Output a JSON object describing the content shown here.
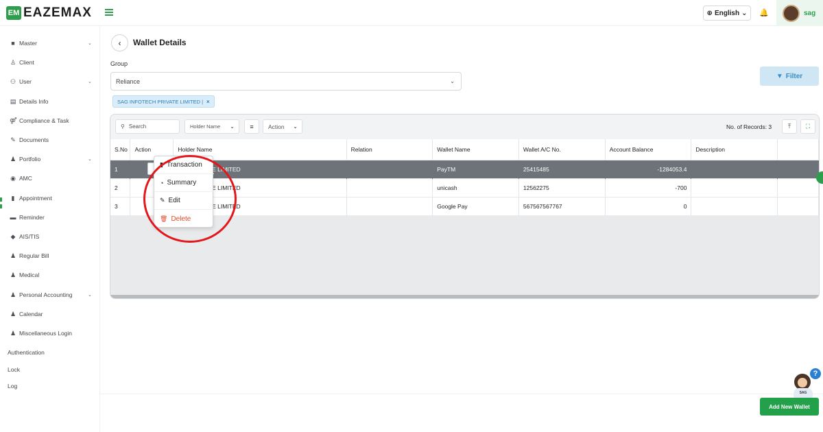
{
  "header": {
    "logo_mark": "EM",
    "logo_text": "EAZEMAX",
    "language": "English",
    "user_name": "sag"
  },
  "sidebar": {
    "items": [
      {
        "label": "Master",
        "icon": "box-icon",
        "chevron": true
      },
      {
        "label": "Client",
        "icon": "client-icon",
        "chevron": false
      },
      {
        "label": "User",
        "icon": "user-group-icon",
        "chevron": true
      },
      {
        "label": "Details Info",
        "icon": "details-icon",
        "chevron": false
      },
      {
        "label": "Compliance & Task",
        "icon": "compliance-icon",
        "chevron": false
      },
      {
        "label": "Documents",
        "icon": "documents-icon",
        "chevron": false
      },
      {
        "label": "Portfolio",
        "icon": "portfolio-icon",
        "chevron": true
      },
      {
        "label": "AMC",
        "icon": "amc-icon",
        "chevron": false
      },
      {
        "label": "Appointment",
        "icon": "appointment-icon",
        "chevron": false
      },
      {
        "label": "Reminder",
        "icon": "reminder-icon",
        "chevron": false
      },
      {
        "label": "AIS/TIS",
        "icon": "tag-icon",
        "chevron": false
      },
      {
        "label": "Regular Bill",
        "icon": "bill-icon",
        "chevron": false
      },
      {
        "label": "Medical",
        "icon": "medical-icon",
        "chevron": false
      },
      {
        "label": "Personal Accounting",
        "icon": "accounting-icon",
        "chevron": true
      },
      {
        "label": "Calendar",
        "icon": "calendar-icon",
        "chevron": false
      },
      {
        "label": "Miscellaneous Login",
        "icon": "login-icon",
        "chevron": false
      }
    ],
    "plain_items": [
      "Authentication",
      "Lock",
      "Log"
    ]
  },
  "page": {
    "title": "Wallet Details",
    "group_label": "Group",
    "group_value": "Reliance",
    "filter_label": "Filter",
    "chip_label": "SAG INFOTECH PRIVATE LIMITED |",
    "chip_close": "×"
  },
  "toolbar": {
    "search_placeholder": "Search",
    "holder_select": "Holder Name",
    "action_select": "Action",
    "records_text": "No. of Records: 3"
  },
  "table": {
    "headers": [
      "S.No",
      "Action",
      "Holder Name",
      "Relation",
      "Wallet Name",
      "Wallet A/C No.",
      "Account Balance",
      "Description"
    ],
    "rows": [
      {
        "sno": "1",
        "holder": "ECH PRIVATE LIMITED",
        "relation": "",
        "wallet": "PayTM",
        "acno": "25415485",
        "balance": "-1284053.4",
        "desc": ""
      },
      {
        "sno": "2",
        "holder": "ECH PRIVATE LIMITED",
        "relation": "",
        "wallet": "unicash",
        "acno": "12562275",
        "balance": "-700",
        "desc": ""
      },
      {
        "sno": "3",
        "holder": "ECH PRIVATE LIMITED",
        "relation": "",
        "wallet": "Google Pay",
        "acno": "567567567767",
        "balance": "0",
        "desc": ""
      }
    ]
  },
  "action_menu": {
    "items": [
      "Transaction",
      "Summary",
      "Edit",
      "Delete"
    ]
  },
  "help": {
    "badge": "?",
    "label": "SAG"
  },
  "add_button": "Add New Wallet",
  "colors": {
    "brand_green": "#2e9e4c",
    "filter_blue": "#3a8ec8",
    "delete_red": "#e04a2a",
    "highlight_ring": "#e3161c"
  }
}
